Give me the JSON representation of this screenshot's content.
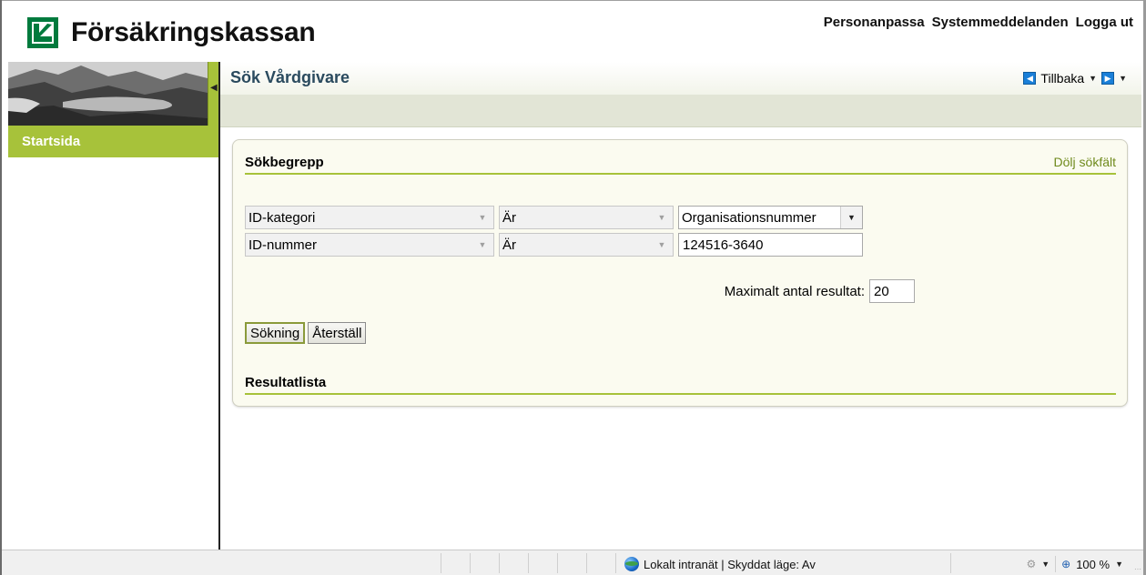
{
  "header": {
    "logo_text": "Försäkringskassan",
    "links": [
      "Personanpassa",
      "Systemmeddelanden",
      "Logga ut"
    ]
  },
  "sidebar": {
    "items": [
      {
        "label": "Startsida"
      }
    ]
  },
  "titlebar": {
    "title": "Sök Vårdgivare",
    "back_label": "Tillbaka"
  },
  "search": {
    "section_title": "Sökbegrepp",
    "toggle_link": "Dölj sökfält",
    "rows": [
      {
        "field": "ID-kategori",
        "operator": "Är",
        "value": "Organisationsnummer"
      },
      {
        "field": "ID-nummer",
        "operator": "Är",
        "value": "124516-3640"
      }
    ],
    "max_label": "Maximalt antal resultat:",
    "max_value": "20",
    "search_button": "Sökning",
    "reset_button": "Återställ",
    "results_title": "Resultatlista"
  },
  "statusbar": {
    "zone_text": "Lokalt intranät | Skyddat läge: Av",
    "zoom": "100 %"
  },
  "colors": {
    "accent_green": "#a7c23a",
    "brand_green": "#007a3d",
    "title_blue": "#2a4a5e"
  },
  "icons": {
    "logo": "forsakringskassan-logo-icon",
    "back": "back-arrow-icon",
    "forward": "forward-arrow-icon",
    "zone": "globe-intranet-icon",
    "zoom": "zoom-icon"
  }
}
